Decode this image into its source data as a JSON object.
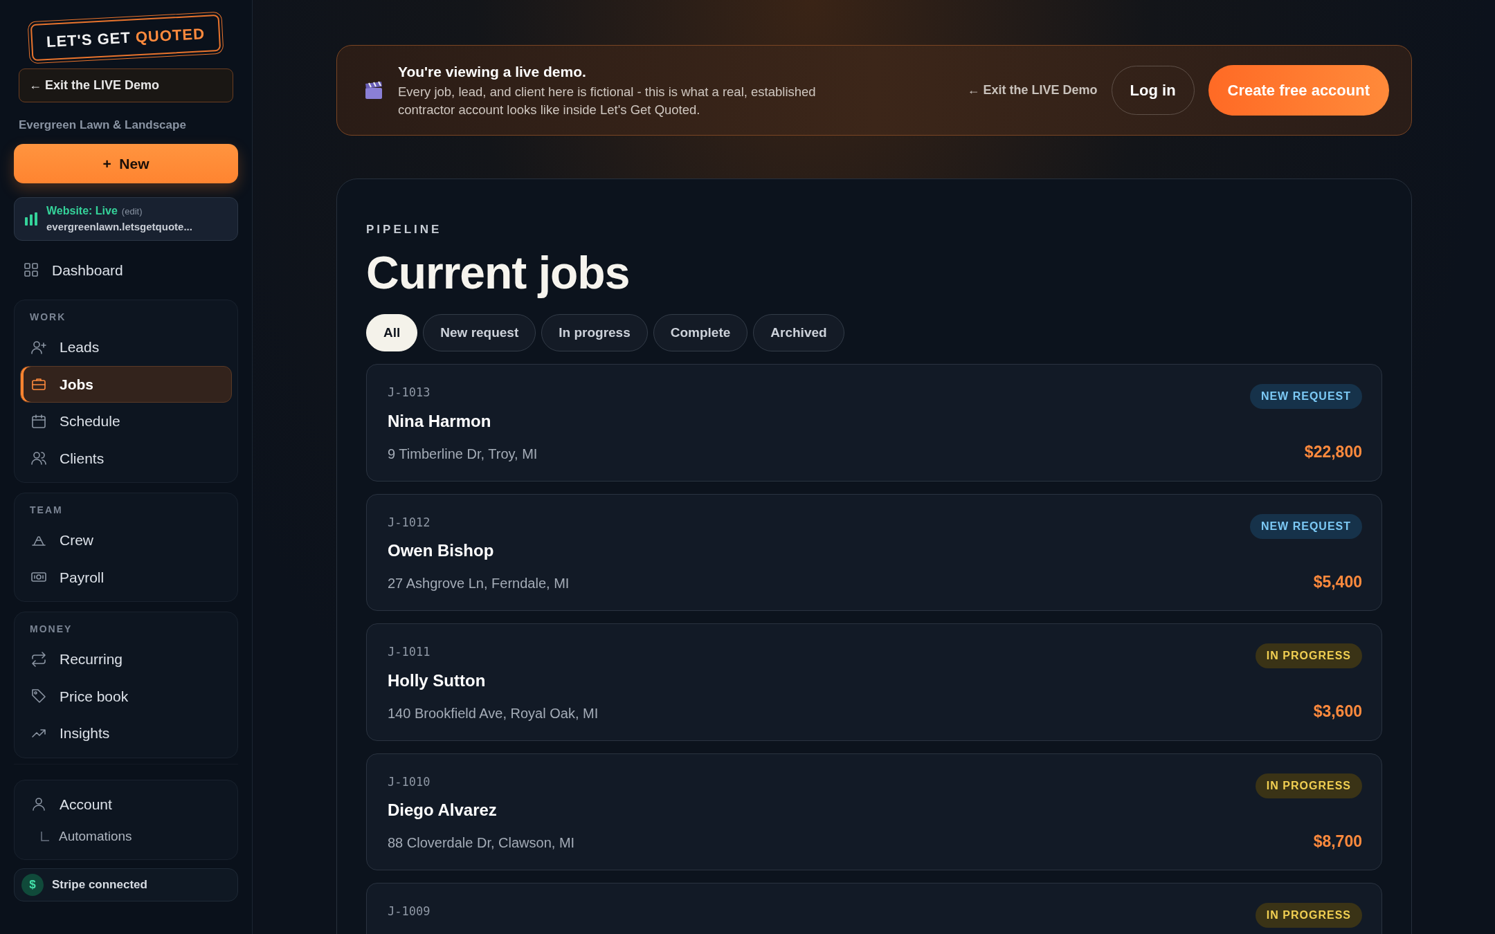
{
  "sidebar": {
    "logo": {
      "part_1": "LET'S GET",
      "part_2": "QUOTED"
    },
    "exit_button": "← Exit the LIVE Demo",
    "company": "Evergreen Lawn & Landscape",
    "new_button": {
      "icon": "+",
      "label": "New"
    },
    "website": {
      "status": "Website: Live",
      "edit": "(edit)",
      "url": "evergreenlawn.letsgetquote..."
    },
    "dashboard": {
      "label": "Dashboard",
      "selected": false
    },
    "groups": [
      {
        "title": "WORK",
        "items": [
          {
            "label": "Leads",
            "selected": false
          },
          {
            "label": "Jobs",
            "selected": true
          },
          {
            "label": "Schedule",
            "selected": false
          },
          {
            "label": "Clients",
            "selected": false
          }
        ]
      },
      {
        "title": "TEAM",
        "items": [
          {
            "label": "Crew",
            "selected": false
          },
          {
            "label": "Payroll",
            "selected": false
          }
        ]
      },
      {
        "title": "MONEY",
        "items": [
          {
            "label": "Recurring",
            "selected": false
          },
          {
            "label": "Price book",
            "selected": false
          },
          {
            "label": "Insights",
            "selected": false
          }
        ]
      }
    ],
    "account": {
      "label": "Account",
      "sub": "Automations"
    },
    "stripe": {
      "icon": "$",
      "label": "Stripe connected"
    }
  },
  "banner": {
    "title": "You're viewing a live demo.",
    "text": "Every job, lead, and client here is fictional - this is what a real, established contractor account looks like inside Let's Get Quoted.",
    "exit_link": "← Exit the LIVE Demo",
    "login": "Log in",
    "create": "Create free account"
  },
  "pipeline": {
    "eyebrow": "PIPELINE",
    "title": "Current jobs",
    "filters": [
      {
        "label": "All",
        "selected": true
      },
      {
        "label": "New request",
        "selected": false
      },
      {
        "label": "In progress",
        "selected": false
      },
      {
        "label": "Complete",
        "selected": false
      },
      {
        "label": "Archived",
        "selected": false
      }
    ],
    "jobs": [
      {
        "id": "J-1013",
        "status": "NEW REQUEST",
        "kind": "new",
        "name": "Nina Harmon",
        "address": "9 Timberline Dr, Troy, MI",
        "amount": "$22,800"
      },
      {
        "id": "J-1012",
        "status": "NEW REQUEST",
        "kind": "new",
        "name": "Owen Bishop",
        "address": "27 Ashgrove Ln, Ferndale, MI",
        "amount": "$5,400"
      },
      {
        "id": "J-1011",
        "status": "IN PROGRESS",
        "kind": "progress",
        "name": "Holly Sutton",
        "address": "140 Brookfield Ave, Royal Oak, MI",
        "amount": "$3,600"
      },
      {
        "id": "J-1010",
        "status": "IN PROGRESS",
        "kind": "progress",
        "name": "Diego Alvarez",
        "address": "88 Cloverdale Dr, Clawson, MI",
        "amount": "$8,700"
      },
      {
        "id": "J-1009",
        "status": "IN PROGRESS",
        "kind": "progress"
      }
    ]
  }
}
